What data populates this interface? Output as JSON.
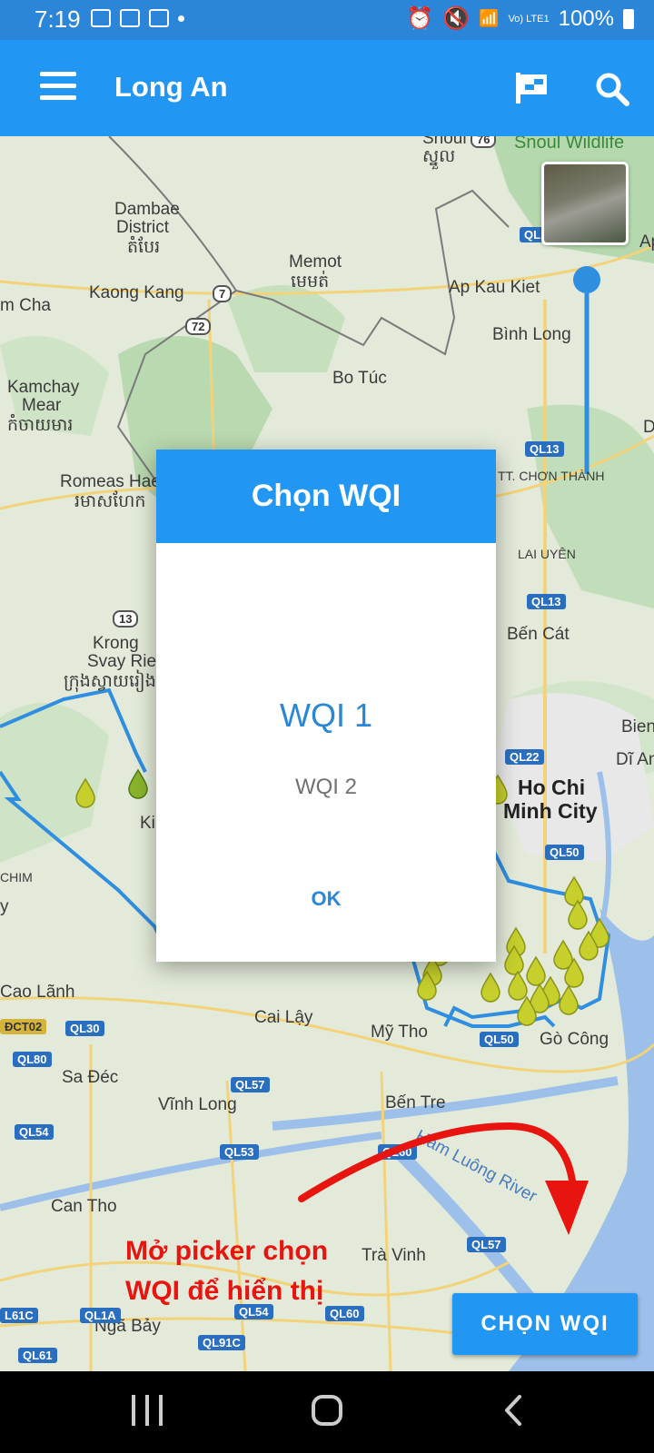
{
  "status_bar": {
    "time": "7:19",
    "battery": "100%",
    "network": "Vo) LTE1"
  },
  "app_bar": {
    "title": "Long An",
    "menu_icon": "menu-icon",
    "flag_icon": "flag-icon",
    "search_icon": "search-icon",
    "color": "#2196f3"
  },
  "map": {
    "places": [
      "Snoul Wildlife",
      "Snoul",
      "ស្នួល",
      "Dambae",
      "District",
      "តំបែរ",
      "Kaong Kang",
      "Memot",
      "មេមត់",
      "m Cha",
      "Ap Kau Kiet",
      "Bình Long",
      "Bo Túc",
      "Kamchay",
      "Mear",
      "កំចាយមារ",
      "Romeas Hae",
      "រមាសហែក",
      "TT. CHƠN THÀNH",
      "LAI UYÊN",
      "Bến Cát",
      "Krong",
      "Svay Rieng",
      "ក្រុងស្វាយរៀង",
      "Bien",
      "Dĩ An",
      "Ho Chi",
      "Minh City",
      "CHIM",
      "Cao Lãnh",
      "Cai Lậy",
      "Mỹ Tho",
      "Gò Công",
      "Sa Đéc",
      "Vĩnh Long",
      "Bến Tre",
      "Can Tho",
      "Trà Vinh",
      "Ngã Bảy",
      "Hàm Luông River",
      "Ki",
      "y",
      "Ap",
      "D",
      "n"
    ],
    "route_shields": [
      "QL13",
      "QL13",
      "QL13",
      "QL22",
      "QL50",
      "QL30",
      "QL80",
      "QL54",
      "QL57",
      "QL53",
      "QL60",
      "QL54",
      "QL1A",
      "QL91C",
      "QL61",
      "L61C",
      "QL50",
      "QL57",
      "QL60",
      "QL1"
    ],
    "yellow_shields": [
      "ĐCT02"
    ],
    "round_shields": [
      "76",
      "7",
      "72",
      "13"
    ],
    "satellite_toggle_icon": "satellite-thumbnail-icon",
    "marker_icon": "water-drop-marker-icon"
  },
  "dialog": {
    "title": "Chọn WQI",
    "options": [
      "WQI 1",
      "WQI 2"
    ],
    "selected": "WQI 1",
    "ok_label": "OK"
  },
  "annotation": {
    "line1": "Mở picker chọn",
    "line2": "WQI để hiển thị",
    "color": "#e8140f",
    "arrow_icon": "red-curved-arrow-icon"
  },
  "action_button": {
    "label": "CHỌN WQI"
  },
  "nav_bar": {
    "recent_icon": "recent-apps-icon",
    "home_icon": "home-icon",
    "back_icon": "back-icon"
  }
}
